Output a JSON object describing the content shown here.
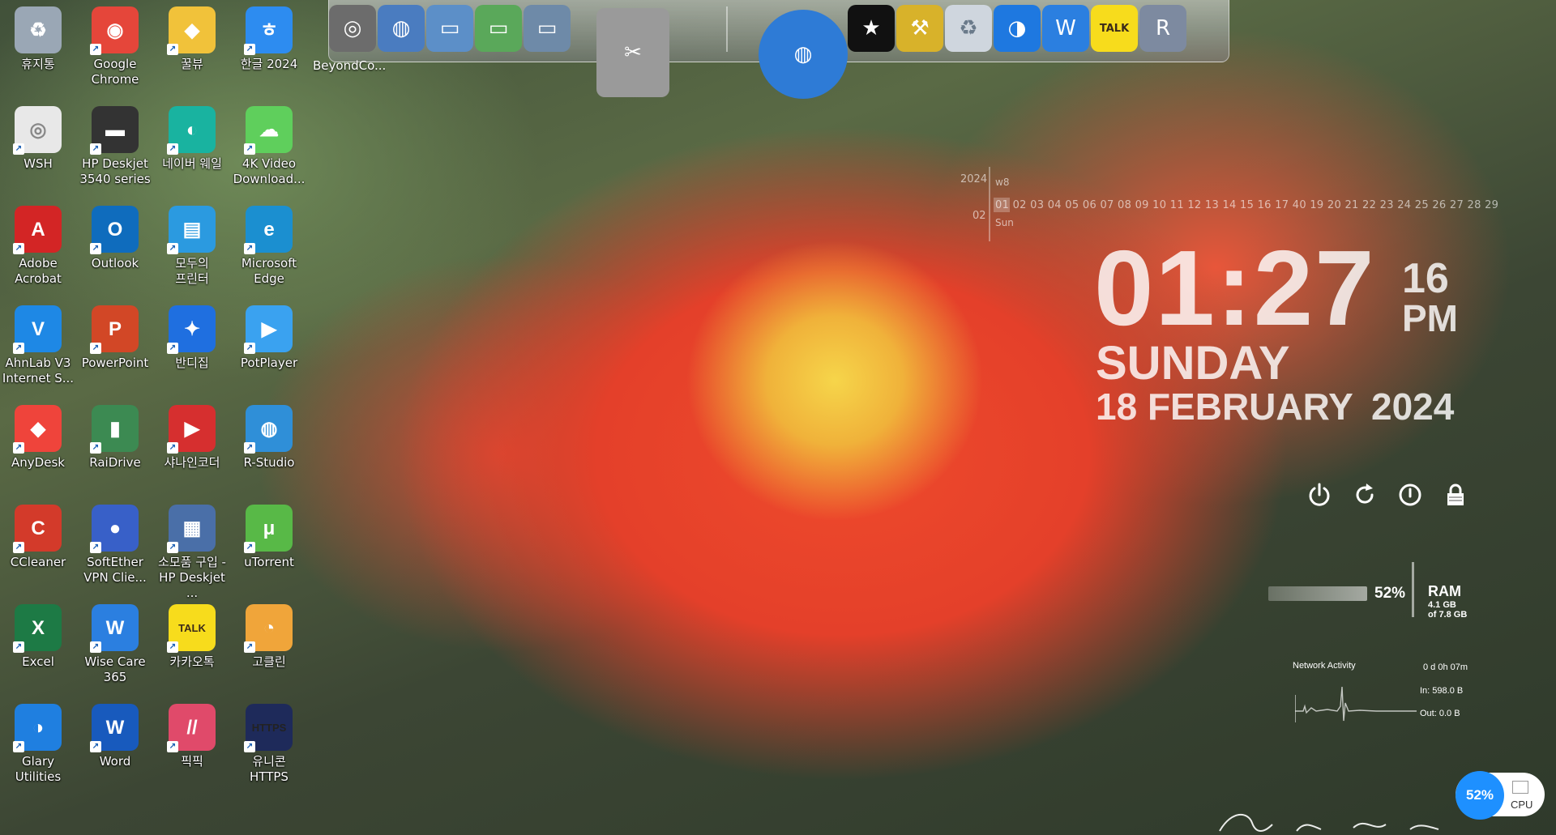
{
  "desktop_icons": [
    {
      "label": "휴지통",
      "color": "#9aa7b5",
      "sym": "♻"
    },
    {
      "label": "Google\nChrome",
      "color": "#e5463a",
      "sym": "◉"
    },
    {
      "label": "꿀뷰",
      "color": "#f1c23a",
      "sym": "◆"
    },
    {
      "label": "한글 2024",
      "color": "#2d8cf0",
      "sym": "ㅎ"
    },
    {
      "label": "WSH",
      "color": "#e8e8e8",
      "sym": "◎"
    },
    {
      "label": "HP Deskjet\n3540 series",
      "color": "#333333",
      "sym": "▬"
    },
    {
      "label": "네이버 웨일",
      "color": "#19b3a0",
      "sym": "◐"
    },
    {
      "label": "4K Video\nDownload...",
      "color": "#5fcf5c",
      "sym": "☁"
    },
    {
      "label": "Adobe\nAcrobat",
      "color": "#d32525",
      "sym": "A"
    },
    {
      "label": "Outlook",
      "color": "#0f6cbd",
      "sym": "O"
    },
    {
      "label": "모두의\n프린터",
      "color": "#2b9ae0",
      "sym": "▤"
    },
    {
      "label": "Microsoft\nEdge",
      "color": "#1b8fd0",
      "sym": "e"
    },
    {
      "label": "AhnLab V3\nInternet S...",
      "color": "#1e88e5",
      "sym": "V"
    },
    {
      "label": "PowerPoint",
      "color": "#d24726",
      "sym": "P"
    },
    {
      "label": "반디집",
      "color": "#1f6fe0",
      "sym": "✦"
    },
    {
      "label": "PotPlayer",
      "color": "#3aa2f0",
      "sym": "▶"
    },
    {
      "label": "AnyDesk",
      "color": "#ef443b",
      "sym": "◆"
    },
    {
      "label": "RaiDrive",
      "color": "#3c8a52",
      "sym": "▮"
    },
    {
      "label": "샤나인코더",
      "color": "#d62f2f",
      "sym": "▶"
    },
    {
      "label": "R-Studio",
      "color": "#2f8fd8",
      "sym": "◍"
    },
    {
      "label": "CCleaner",
      "color": "#d33a2a",
      "sym": "C"
    },
    {
      "label": "SoftEther\nVPN Clie...",
      "color": "#3860c8",
      "sym": "●"
    },
    {
      "label": "소모품 구입 -\nHP Deskjet ...",
      "color": "#4a6fa8",
      "sym": "▦"
    },
    {
      "label": "uTorrent",
      "color": "#58b947",
      "sym": "μ"
    },
    {
      "label": "Excel",
      "color": "#1d7a45",
      "sym": "X"
    },
    {
      "label": "Wise Care\n365",
      "color": "#2b7fe0",
      "sym": "W"
    },
    {
      "label": "카카오톡",
      "color": "#f7dc1c",
      "sym": "TALK"
    },
    {
      "label": "고클린",
      "color": "#f0a53a",
      "sym": "◔"
    },
    {
      "label": "Glary Utilities",
      "color": "#1f7fe0",
      "sym": "◑"
    },
    {
      "label": "Word",
      "color": "#185abd",
      "sym": "W"
    },
    {
      "label": "픽픽",
      "color": "#e04a6a",
      "sym": "//"
    },
    {
      "label": "유니콘\nHTTPS",
      "color": "#1e2a5a",
      "sym": "HTTPS"
    }
  ],
  "dock": {
    "caption": "BeyondCo...",
    "items": [
      {
        "name": "disc-burner-icon",
        "color": "#6c6c6c",
        "sym": "◎"
      },
      {
        "name": "network-globe-icon",
        "color": "#4a7cc0",
        "sym": "◍"
      },
      {
        "name": "folder-icon",
        "color": "#5c8fc8",
        "sym": "▭"
      },
      {
        "name": "green-folder-icon",
        "color": "#5aa85a",
        "sym": "▭"
      },
      {
        "name": "pictures-folder-icon",
        "color": "#6e8aa8",
        "sym": "▭"
      },
      {
        "name": "utilities-tools-icon",
        "color": "#9a9a9a",
        "sym": "✂"
      },
      {
        "name": "globe-icon",
        "color": "#2e7bd6",
        "sym": "◍"
      },
      {
        "name": "tshirt-icon",
        "color": "#111111",
        "sym": "★"
      },
      {
        "name": "hammer-tools-icon",
        "color": "#d8b22a",
        "sym": "⚒"
      },
      {
        "name": "recycle-bin-icon",
        "color": "#cfd6de",
        "sym": "♻"
      },
      {
        "name": "glary-moon-icon",
        "color": "#1e78e0",
        "sym": "◑"
      },
      {
        "name": "wise-care-icon",
        "color": "#2b7fe0",
        "sym": "W"
      },
      {
        "name": "kakaotalk-icon",
        "color": "#f7dc1c",
        "sym": "TALK"
      },
      {
        "name": "r-studio-icon",
        "color": "#7d8aa0",
        "sym": "R"
      }
    ]
  },
  "calendar": {
    "year": "2024",
    "week": "w8",
    "month": "02",
    "days": "01 02 03 04 05 06 07 08 09 10 11 12 13 14 15 16 17 40 19 20 21 22 23 24 25 26 27 28 29",
    "weekday_short": "Sun"
  },
  "clock": {
    "time": "01:27",
    "seconds": "16",
    "ampm": "PM",
    "weekday": "SUNDAY",
    "date": "18 FEBRUARY",
    "year": "2024"
  },
  "power": [
    "power-icon",
    "restart-icon",
    "shutdown-icon",
    "lock-icon"
  ],
  "ram": {
    "percent": "52%",
    "title": "RAM",
    "used": "4.1 GB",
    "total": "of 7.8 GB"
  },
  "network": {
    "title": "Network Activity",
    "uptime": "0 d 0h 07m",
    "in": "In: 598.0 B",
    "out": "Out: 0.0 B"
  },
  "cpu": {
    "percent": "52%",
    "label": "CPU"
  }
}
